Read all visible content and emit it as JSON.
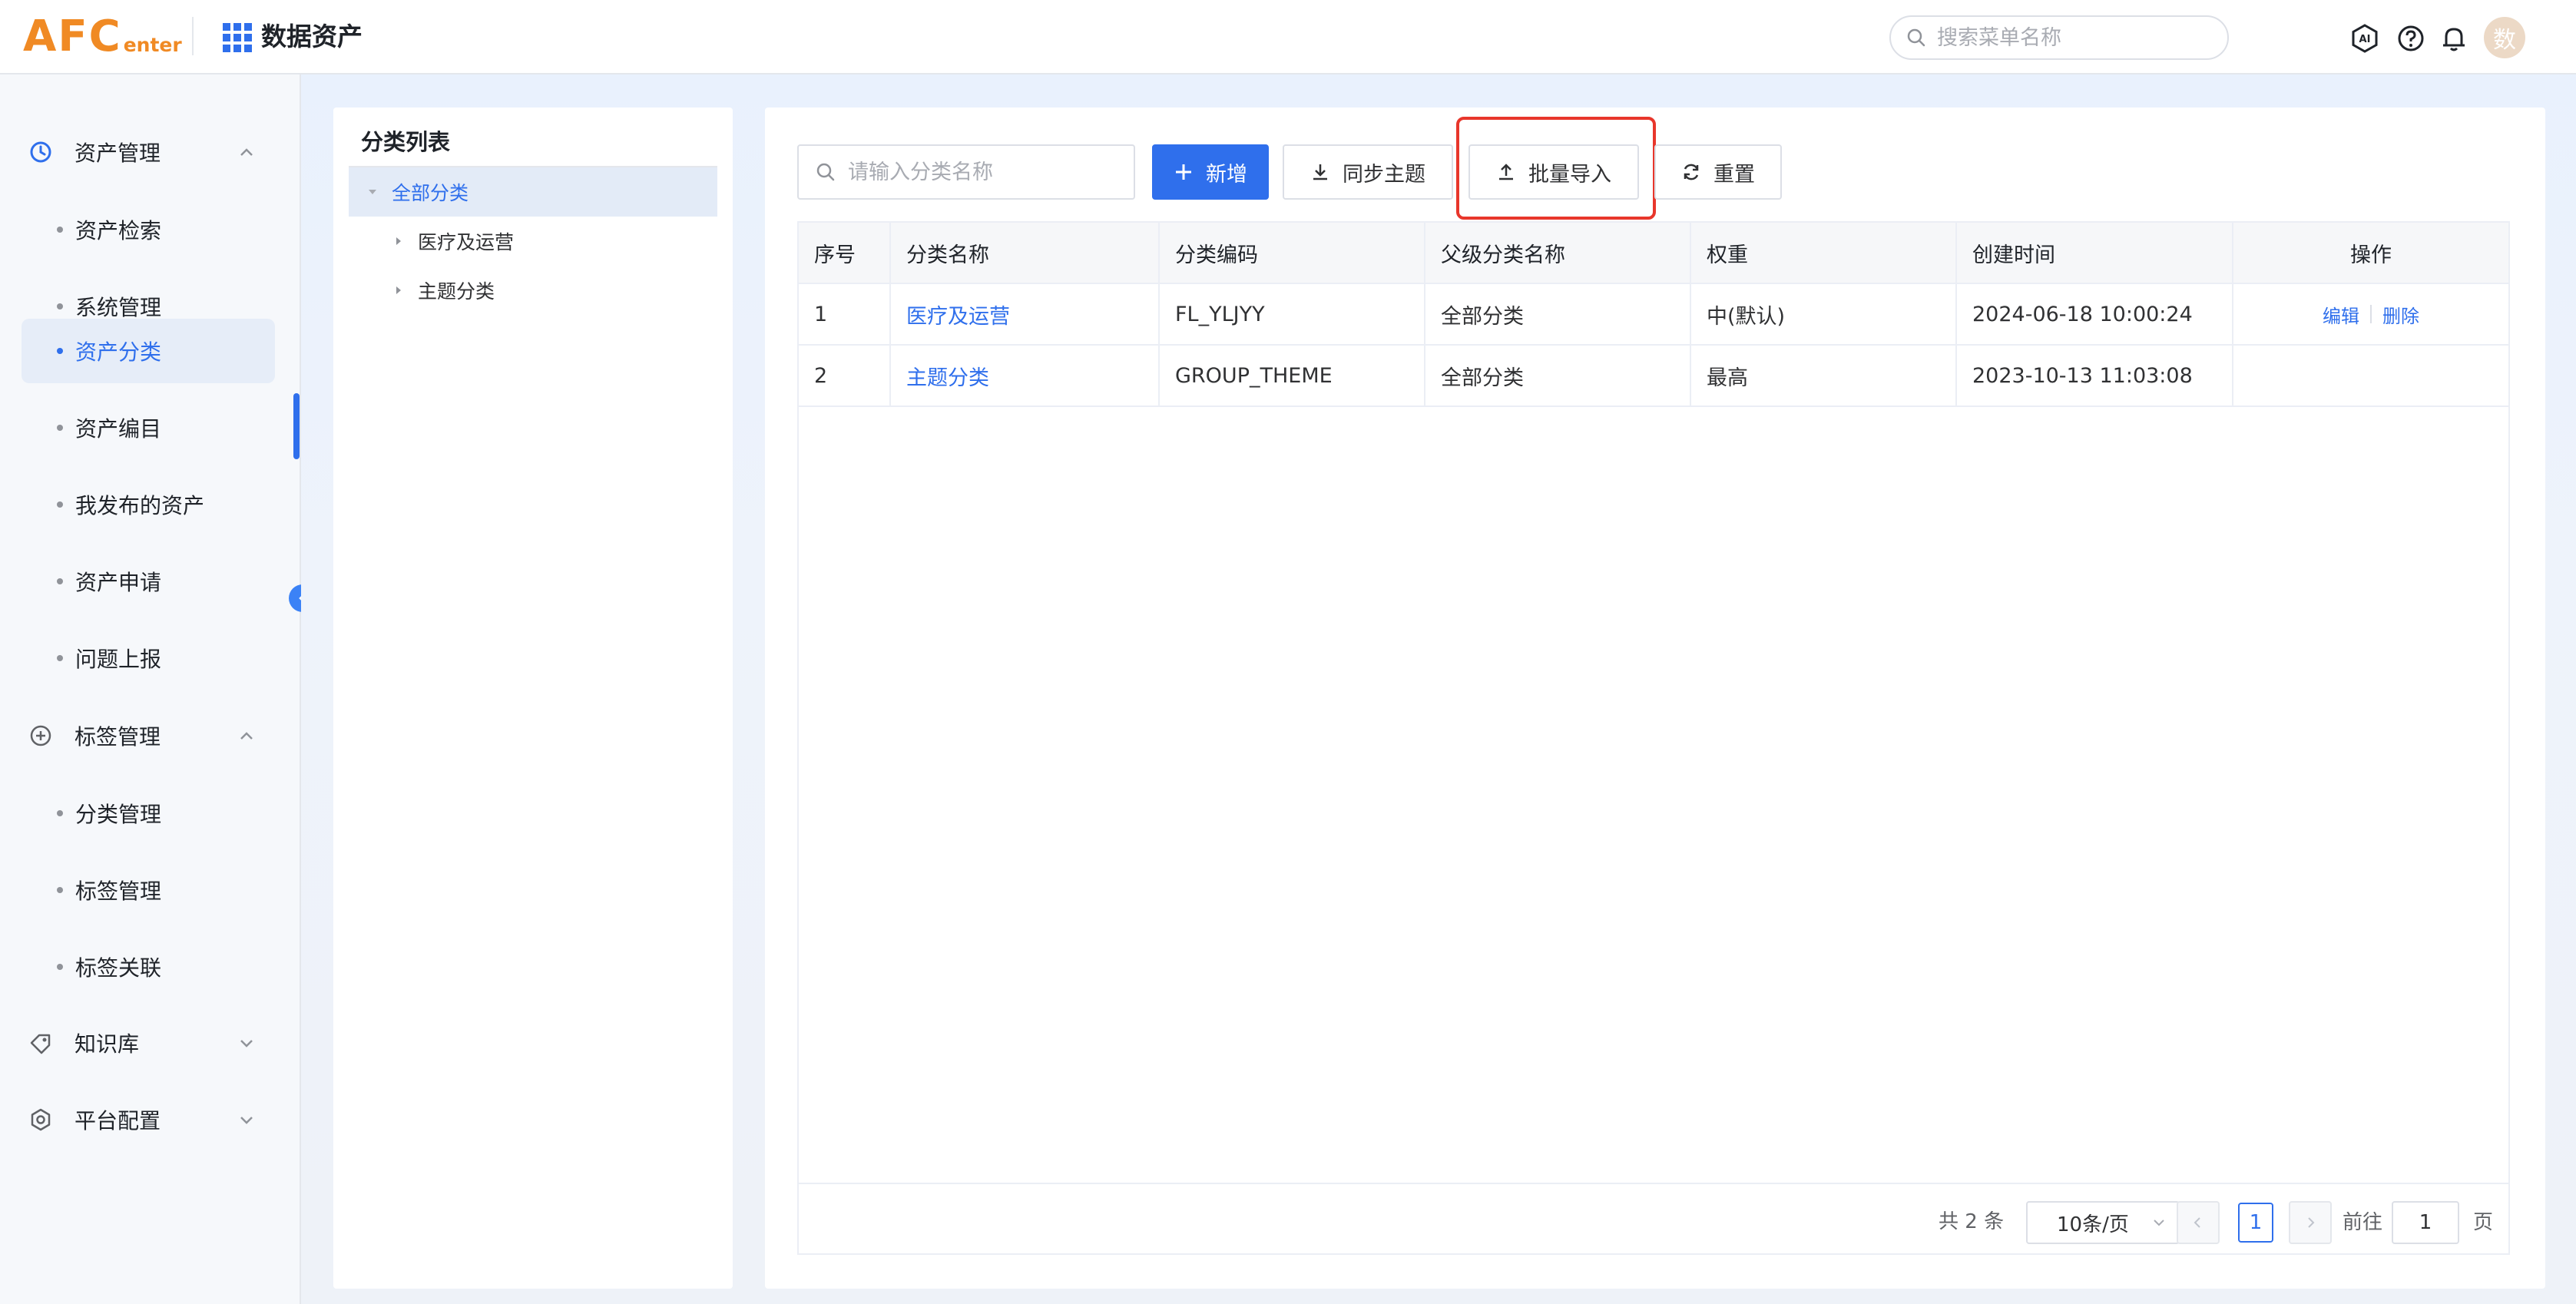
{
  "header": {
    "logo_main": "AFC",
    "logo_sub": "enter",
    "app_title": "数据资产",
    "search_placeholder": "搜索菜单名称",
    "avatar_text": "数"
  },
  "sidebar": {
    "groups": [
      {
        "label": "资产管理",
        "icon": "clock-icon",
        "expanded": true
      },
      {
        "label": "标签管理",
        "icon": "plus-circle-icon",
        "expanded": true
      },
      {
        "label": "知识库",
        "icon": "tag-icon",
        "expanded": false
      },
      {
        "label": "平台配置",
        "icon": "settings-icon",
        "expanded": false
      }
    ],
    "asset_items": [
      "资产检索",
      "系统管理",
      "资产分类",
      "资产编目",
      "我发布的资产",
      "资产申请",
      "问题上报"
    ],
    "tag_items": [
      "分类管理",
      "标签管理",
      "标签关联"
    ],
    "active_item": "资产分类"
  },
  "tree": {
    "title": "分类列表",
    "root": "全部分类",
    "children": [
      "医疗及运营",
      "主题分类"
    ]
  },
  "toolbar": {
    "search_placeholder": "请输入分类名称",
    "add_label": "新增",
    "sync_label": "同步主题",
    "import_label": "批量导入",
    "reset_label": "重置"
  },
  "table": {
    "columns": [
      "序号",
      "分类名称",
      "分类编码",
      "父级分类名称",
      "权重",
      "创建时间",
      "操作"
    ],
    "rows": [
      {
        "index": "1",
        "name": "医疗及运营",
        "code": "FL_YLJYY",
        "parent": "全部分类",
        "weight": "中(默认)",
        "created": "2024-06-18 10:00:24",
        "edit": "编辑",
        "delete": "删除"
      },
      {
        "index": "2",
        "name": "主题分类",
        "code": "GROUP_THEME",
        "parent": "全部分类",
        "weight": "最高",
        "created": "2023-10-13 11:03:08"
      }
    ]
  },
  "pagination": {
    "total_text": "共 2 条",
    "page_size": "10条/页",
    "current_page": "1",
    "goto_prefix": "前往",
    "goto_value": "1",
    "goto_suffix": "页"
  },
  "colors": {
    "primary": "#2f6fec",
    "highlight": "#e8362b",
    "logo": "#f08a24"
  }
}
